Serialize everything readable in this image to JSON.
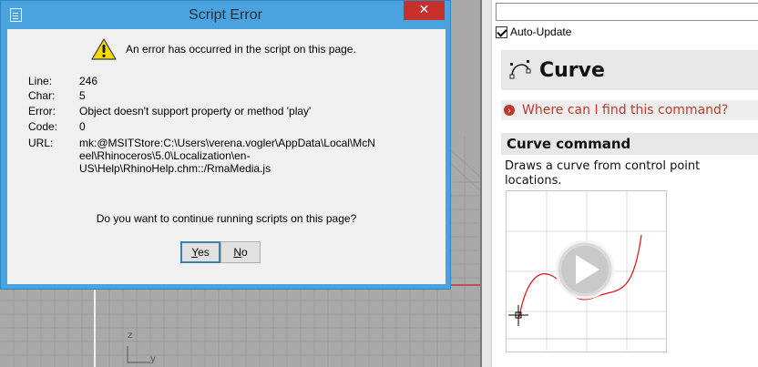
{
  "dialog": {
    "title": "Script Error",
    "close_glyph": "✕",
    "message": "An error has occurred in the script on this page.",
    "fields": [
      {
        "key": "Line:",
        "value": "246"
      },
      {
        "key": "Char:",
        "value": "5"
      },
      {
        "key": "Error:",
        "value": "Object doesn't support property or method 'play'"
      },
      {
        "key": "Code:",
        "value": "0"
      },
      {
        "key": "URL:",
        "value_lines": [
          "mk:@MSITStore:C:\\Users\\verena.vogler\\AppData\\Local\\McN",
          "eel\\Rhinoceros\\5.0\\Localization\\en-",
          "US\\Help\\RhinoHelp.chm::/RmaMedia.js"
        ]
      }
    ],
    "question": "Do you want to continue running scripts on this page?",
    "yes_mnemonic": "Y",
    "yes_rest": "es",
    "no_mnemonic": "N",
    "no_rest": "o",
    "accent_color": "#4aa3df",
    "close_color": "#c7302b"
  },
  "viewport": {
    "axis_z": "z",
    "axis_y": "y"
  },
  "help_panel": {
    "auto_update_label": "Auto-Update",
    "auto_update_checked": true,
    "command_name": "Curve",
    "where_link": "Where can I find this command?",
    "section_title": "Curve command",
    "description": "Draws a curve from control point locations.",
    "link_color": "#c0392b"
  },
  "icons": {
    "app": "document-icon",
    "warning": "warning-icon",
    "curve": "curve-icon",
    "where": "info-bullet-icon",
    "play": "play-icon",
    "cursor": "crosshair-icon"
  }
}
